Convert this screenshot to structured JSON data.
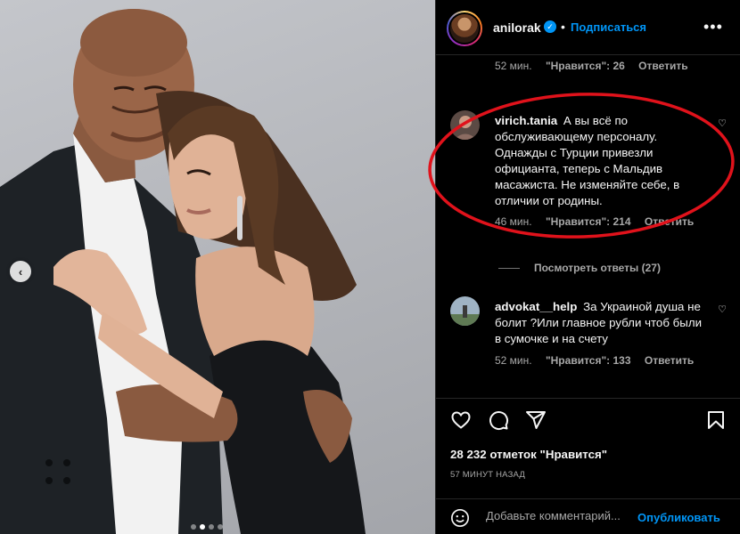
{
  "post": {
    "username": "anilorak",
    "verified_mark": "✓",
    "separator": "•",
    "follow_label": "Подписаться",
    "more_label": "•••"
  },
  "comments": [
    {
      "meta_time": "52 мин.",
      "meta_likes": "\"Нравится\": 26",
      "meta_reply": "Ответить"
    },
    {
      "user": "virich.tania",
      "text": "А вы всё по обслуживающему персоналу. Однажды с Турции привезли официанта, теперь с Мальдив масажиста. Не изменяйте себе, в отличии от родины.",
      "meta_time": "46 мин.",
      "meta_likes": "\"Нравится\": 214",
      "meta_reply": "Ответить",
      "view_replies": "Посмотреть ответы (27)"
    },
    {
      "user": "advokat__help",
      "text": "За Украиной душа не болит ?Или главное рубли чтоб были в сумочке и на счету",
      "meta_time": "52 мин.",
      "meta_likes": "\"Нравится\": 133",
      "meta_reply": "Ответить"
    }
  ],
  "likes_text": "28 232 отметок \"Нравится\"",
  "timestamp": "57 МИНУТ НАЗАД",
  "add_comment": {
    "placeholder": "Добавьте комментарий...",
    "publish_label": "Опубликовать"
  },
  "carousel": {
    "prev_label": "‹",
    "slide_count": 4,
    "active_slide": 2
  },
  "colors": {
    "accent": "#0095f6",
    "annotation": "#e0121b",
    "muted": "#a8a8a8"
  },
  "icons": [
    "heart-icon",
    "comment-icon",
    "share-icon",
    "bookmark-icon",
    "emoji-icon",
    "more-icon",
    "verified-icon",
    "chevron-left-icon"
  ]
}
